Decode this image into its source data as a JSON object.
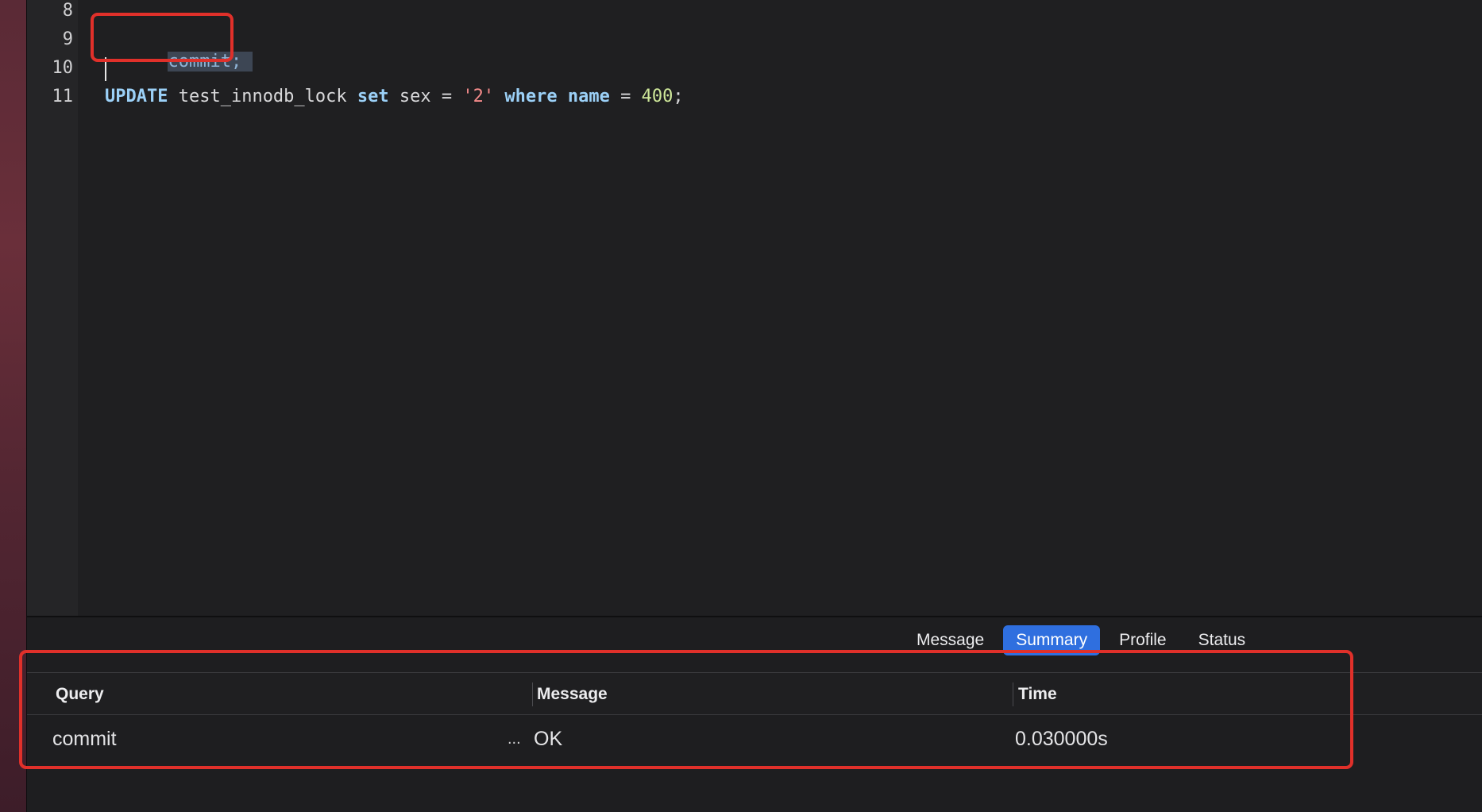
{
  "editor": {
    "line_numbers": [
      "8",
      "9",
      "10",
      "11"
    ],
    "lines": {
      "line9_selected": "commit;",
      "line11": {
        "kw_update": "UPDATE",
        "table": " test_innodb_lock ",
        "kw_set": "set",
        "col": " sex = ",
        "str_val": "'2'",
        "space1": " ",
        "kw_where": "where",
        "space2": " ",
        "kw_name": "name",
        "eq": " = ",
        "num_val": "400",
        "semi": ";"
      }
    }
  },
  "panel": {
    "tabs": [
      {
        "label": "Message",
        "active": false
      },
      {
        "label": "Summary",
        "active": true
      },
      {
        "label": "Profile",
        "active": false
      },
      {
        "label": "Status",
        "active": false
      }
    ],
    "columns": [
      "Query",
      "Message",
      "Time"
    ],
    "rows": [
      {
        "query": "commit",
        "ellipsis": "...",
        "message": "OK",
        "time": "0.030000s"
      }
    ]
  },
  "colors": {
    "annotation_red": "#e0302a",
    "active_tab_blue": "#2f6fdf",
    "keyword": "#9bd0f7",
    "string": "#f48a8a",
    "number": "#cfe89a"
  }
}
